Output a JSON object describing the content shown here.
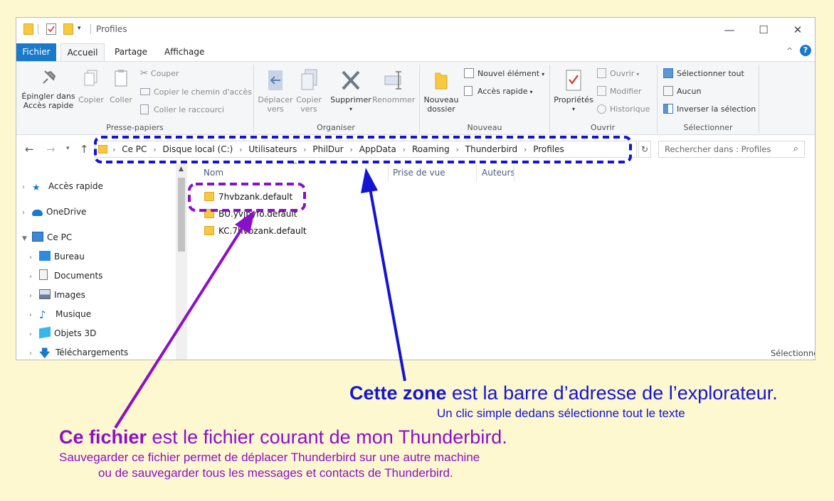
{
  "window": {
    "title": "Profiles",
    "controls": {
      "minimize": "—",
      "maximize": "☐",
      "close": "✕"
    },
    "help": "?",
    "collapse": "^"
  },
  "tabs": [
    "Fichier",
    "Accueil",
    "Partage",
    "Affichage"
  ],
  "ribbon": {
    "presse_papiers": {
      "label": "Presse-papiers",
      "pin_line1": "Épingler dans",
      "pin_line2": "Accès rapide",
      "copy": "Copier",
      "paste": "Coller",
      "cut": "Couper",
      "copy_path": "Copier le chemin d'accès",
      "paste_shortcut": "Coller le raccourci"
    },
    "organiser": {
      "label": "Organiser",
      "move_line1": "Déplacer",
      "move_line2": "vers",
      "copyto_line1": "Copier",
      "copyto_line2": "vers",
      "delete": "Supprimer",
      "rename": "Renommer"
    },
    "nouveau": {
      "label": "Nouveau",
      "new_folder_line1": "Nouveau",
      "new_folder_line2": "dossier",
      "new_item": "Nouvel élément",
      "quick_access": "Accès rapide"
    },
    "ouvrir": {
      "label": "Ouvrir",
      "properties": "Propriétés",
      "open": "Ouvrir",
      "modify": "Modifier",
      "history": "Historique"
    },
    "selectionner": {
      "label": "Sélectionner",
      "select_all": "Sélectionner tout",
      "none": "Aucun",
      "invert": "Inverser la sélection"
    }
  },
  "address": {
    "crumbs": [
      "Ce PC",
      "Disque local (C:)",
      "Utilisateurs",
      "PhilDur",
      "AppData",
      "Roaming",
      "Thunderbird",
      "Profiles"
    ],
    "search_placeholder": "Rechercher dans : Profiles"
  },
  "nav": [
    {
      "label": "Accès rapide",
      "icon": "star-icon"
    },
    {
      "label": "OneDrive",
      "icon": "cloud-icon"
    },
    {
      "label": "Ce PC",
      "icon": "computer-icon"
    },
    {
      "label": "Bureau",
      "icon": "desktop-icon"
    },
    {
      "label": "Documents",
      "icon": "document-icon"
    },
    {
      "label": "Images",
      "icon": "image-icon"
    },
    {
      "label": "Musique",
      "icon": "music-icon"
    },
    {
      "label": "Objets 3D",
      "icon": "cube-icon"
    },
    {
      "label": "Téléchargements",
      "icon": "download-icon"
    }
  ],
  "columns": [
    "Nom",
    "Prise de vue",
    "Auteurs"
  ],
  "files": [
    "7hvbzank.default",
    "BU.yvjbyfo.default",
    "KC.7hvbzank.default"
  ],
  "preview_text": "Sélectionnez un fichier à afficher.",
  "annotations": {
    "address_bold": "Cette zone",
    "address_rest": " est la barre d’adresse de l’explorateur.",
    "address_sub": "Un clic simple dedans sélectionne tout le texte",
    "file_bold": "Ce fichier",
    "file_rest": " est le fichier courant de mon Thunderbird.",
    "file_sub1": "Sauvegarder ce fichier permet de déplacer Thunderbird sur une autre machine",
    "file_sub2": "ou de sauvegarder tous les messages et contacts de Thunderbird."
  },
  "colors": {
    "accent": "#1979ca",
    "blue_annot": "#1414d2",
    "purple_annot": "#8c0fc8",
    "page_bg": "#fdf8cf"
  }
}
